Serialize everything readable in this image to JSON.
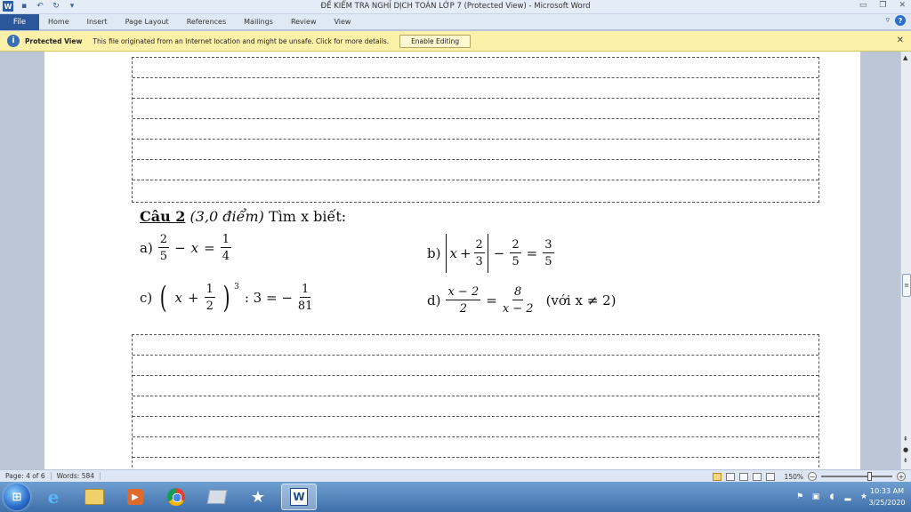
{
  "window": {
    "title": "ĐỀ KIỂM TRA NGHỈ DỊCH TOÁN  LỚP 7 (Protected View)  -  Microsoft Word",
    "word_logo": "W"
  },
  "ribbon": {
    "tabs": [
      "File",
      "Home",
      "Insert",
      "Page Layout",
      "References",
      "Mailings",
      "Review",
      "View"
    ]
  },
  "protected_view": {
    "label": "Protected View",
    "message": "This file originated from an Internet location and might be unsafe. Click for more details.",
    "button": "Enable Editing"
  },
  "document": {
    "question": {
      "number": "Câu 2",
      "points": "(3,0 điểm)",
      "prompt": "Tìm x biết:"
    },
    "problems": {
      "a": {
        "label": "a)",
        "f1_num": "2",
        "f1_den": "5",
        "minus": "−",
        "var": "x",
        "eq": "=",
        "f2_num": "1",
        "f2_den": "4"
      },
      "b": {
        "label": "b)",
        "var": "x",
        "plus": "+",
        "f1_num": "2",
        "f1_den": "3",
        "minus": "−",
        "f2_num": "2",
        "f2_den": "5",
        "eq": "=",
        "f3_num": "3",
        "f3_den": "5"
      },
      "c": {
        "label": "c)",
        "var": "x",
        "plus": "+",
        "f1_num": "1",
        "f1_den": "2",
        "exp": "3",
        "rest": ": 3 = −",
        "f2_num": "1",
        "f2_den": "81"
      },
      "d": {
        "label": "d)",
        "f1_num": "x − 2",
        "f1_den": "2",
        "eq": "=",
        "f2_num": "8",
        "f2_den": "x − 2",
        "note": "(với x ≠ 2)"
      }
    }
  },
  "statusbar": {
    "page": "Page: 4 of 6",
    "words": "Words: 584",
    "zoom": "150%",
    "zoom_level_percent": 150
  },
  "taskbar": {
    "time": "10:33 AM",
    "date": "3/25/2020",
    "apps": [
      "start-orb",
      "internet-explorer-icon",
      "file-explorer-icon",
      "media-player-icon",
      "chrome-icon",
      "app-icon",
      "star-app-icon",
      "word-icon"
    ]
  },
  "colors": {
    "file_tab": "#2b579a",
    "protected_bar": "#fdf1a9",
    "taskbar": "#4f7fb9"
  }
}
